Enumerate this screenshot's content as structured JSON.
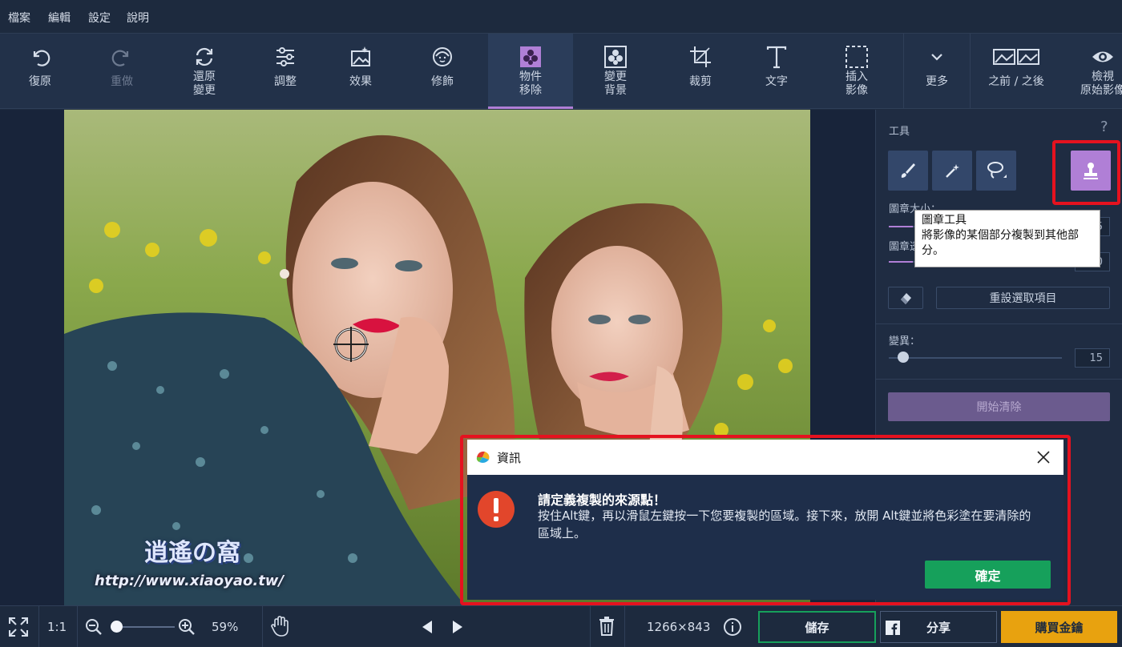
{
  "menu": {
    "file": "檔案",
    "edit": "編輯",
    "settings": "設定",
    "help": "說明"
  },
  "toolbar": {
    "undo": "復原",
    "redo": "重做",
    "revert_1": "還原",
    "revert_2": "變更",
    "adjust": "調整",
    "effects": "效果",
    "retouch": "修飾",
    "object_removal_1": "物件",
    "object_removal_2": "移除",
    "change_bg_1": "變更",
    "change_bg_2": "背景",
    "crop": "裁剪",
    "text": "文字",
    "insert_image_1": "插入",
    "insert_image_2": "影像",
    "more": "更多",
    "before_after": "之前 / 之後",
    "view_original_1": "檢視",
    "view_original_2": "原始影像"
  },
  "right_panel": {
    "tools_title": "工具",
    "help_mark": "?",
    "brush_size_label": "圖章大小：",
    "brush_size_value": "5",
    "opacity_label": "圖章透明度：",
    "opacity_value": "0",
    "reset_selection": "重設選取項目",
    "variance_label": "變異：",
    "variance_value": "15",
    "start_erase": "開始清除",
    "active_tool_color": "#b07fd6"
  },
  "tooltip": {
    "title": "圖章工具",
    "body": "將影像的某個部分複製到其他部分。"
  },
  "dialog": {
    "title": "資訊",
    "heading": "請定義複製的來源點！",
    "body": "按住Alt鍵，再以滑鼠左鍵按一下您要複製的區域。接下來，放開 Alt鍵並將色彩塗在要清除的區域上。",
    "ok": "確定"
  },
  "bottom": {
    "ratio": "1:1",
    "zoom": "59%",
    "image_size": "1266×843",
    "save": "儲存",
    "share": "分享",
    "buy": "購買金鑰"
  },
  "watermark": {
    "url": "http://www.xiaoyao.tw/",
    "logo": "逍遙の窩"
  },
  "colors": {
    "accent": "#b07fd6",
    "ok_green": "#16a05b",
    "buy_orange": "#e8a20f",
    "highlight_red": "#e5121f"
  }
}
